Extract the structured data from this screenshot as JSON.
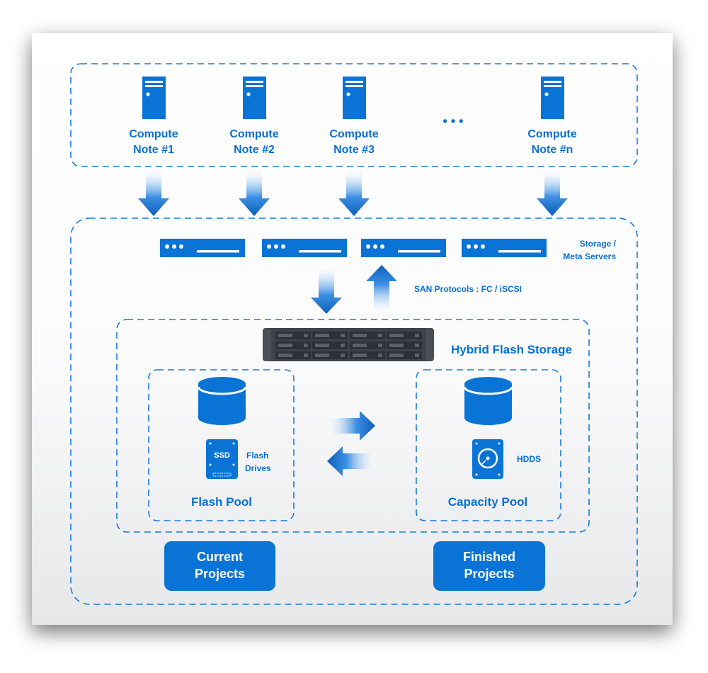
{
  "compute_nodes": [
    {
      "line1": "Compute",
      "line2": "Note #1"
    },
    {
      "line1": "Compute",
      "line2": "Note #2"
    },
    {
      "line1": "Compute",
      "line2": "Note #3"
    },
    {
      "line1": "Compute",
      "line2": "Note #n"
    }
  ],
  "ellipsis": "• • •",
  "storage_servers": {
    "line1": "Storage /",
    "line2": "Meta Servers"
  },
  "san_protocols": "SAN Protocols : FC / iSCSI",
  "hybrid_storage": "Hybrid Flash Storage",
  "flash_pool": {
    "title": "Flash Pool",
    "ssd_label": "SSD",
    "drives_line1": "Flash",
    "drives_line2": "Drives"
  },
  "capacity_pool": {
    "title": "Capacity Pool",
    "hdd_label": "HDDS"
  },
  "buttons": {
    "current": {
      "line1": "Current",
      "line2": "Projects"
    },
    "finished": {
      "line1": "Finished",
      "line2": "Projects"
    }
  },
  "colors": {
    "accent": "#0a74d6",
    "device_gray": "#4a4f57"
  }
}
